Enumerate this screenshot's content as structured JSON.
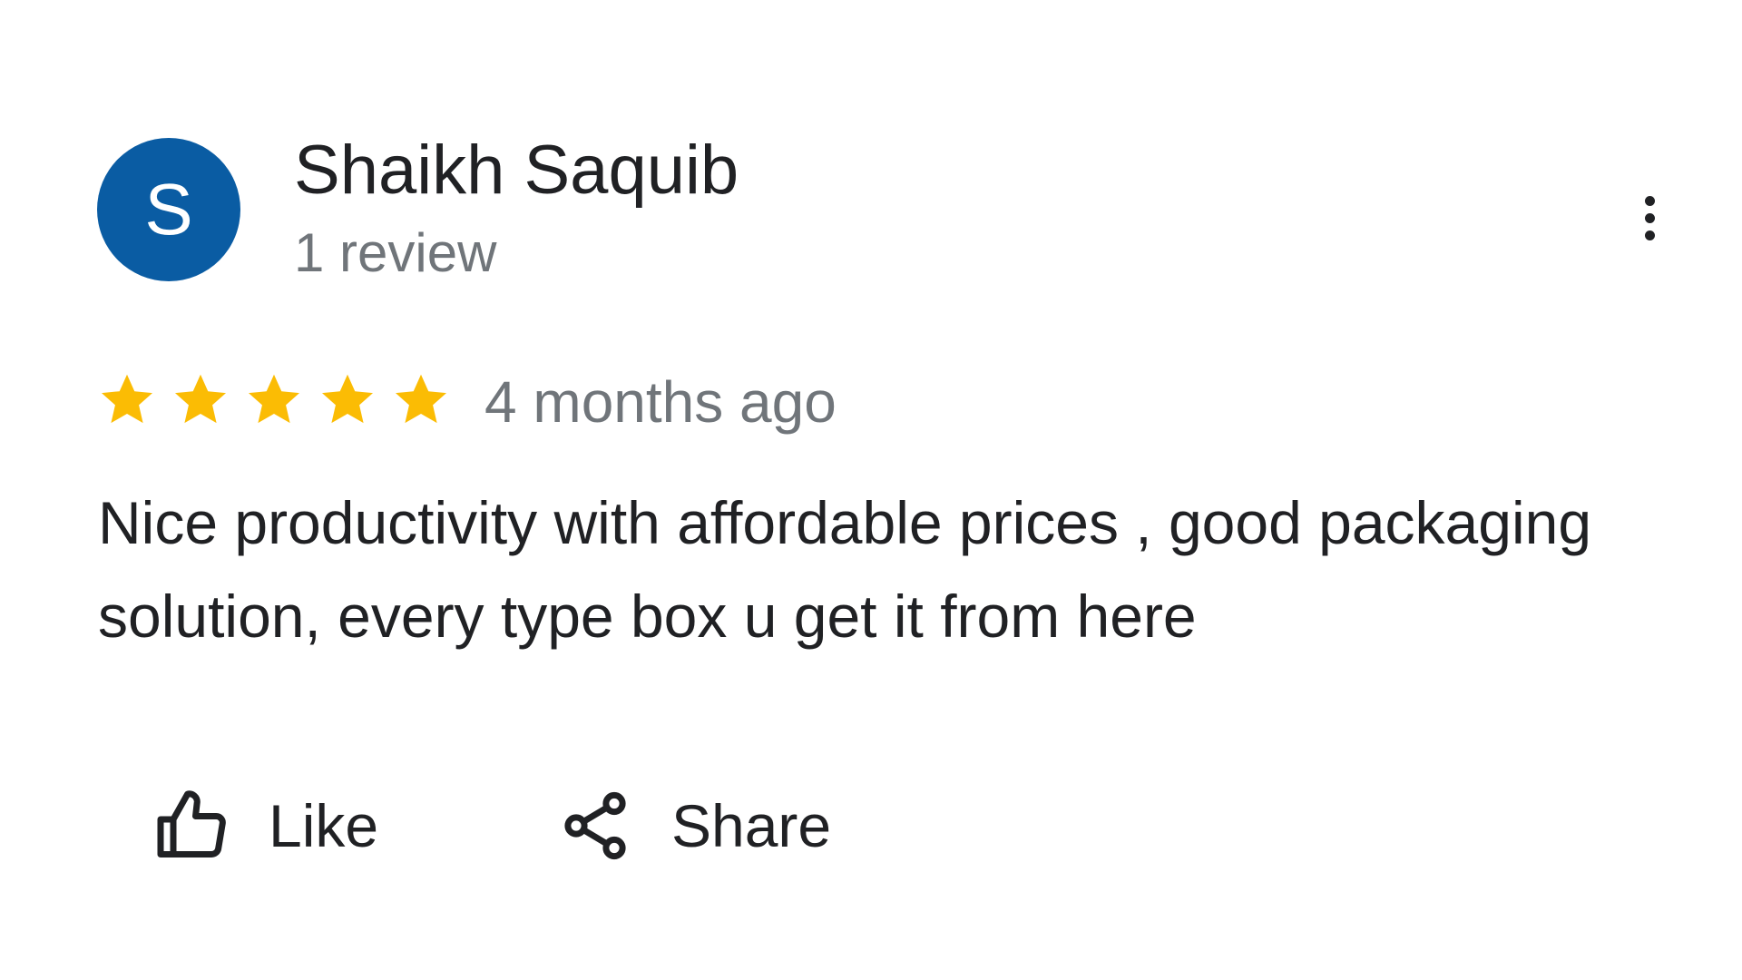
{
  "review": {
    "author": {
      "initial": "S",
      "name": "Shaikh Saquib",
      "review_count": "1 review",
      "avatar_color": "#0a5ca3"
    },
    "more_icon": "more-vertical-icon",
    "rating": {
      "value": 5,
      "max": 5,
      "star_color": "#fbbc04",
      "star_icon": "star-icon"
    },
    "time_ago": "4 months ago",
    "text": "Nice productivity with affordable prices , good packaging solution, every type box u get it from here",
    "actions": {
      "like": {
        "label": "Like",
        "icon": "thumbs-up-icon"
      },
      "share": {
        "label": "Share",
        "icon": "share-icon"
      }
    }
  }
}
